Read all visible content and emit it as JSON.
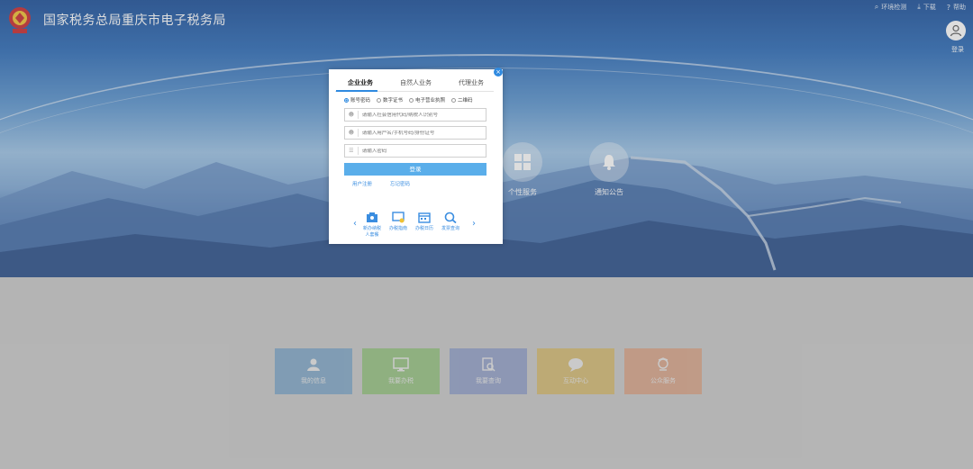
{
  "header": {
    "site_title": "国家税务总局重庆市电子税务局",
    "links": [
      {
        "label": "环境检测",
        "icon": "magnifier-icon"
      },
      {
        "label": "下载",
        "icon": "download-icon"
      },
      {
        "label": "帮助",
        "icon": "help-icon"
      }
    ],
    "user_login_label": "登录"
  },
  "hero_features": [
    {
      "label": "个性服务",
      "icon": "grid-icon"
    },
    {
      "label": "通知公告",
      "icon": "bell-icon"
    }
  ],
  "login_modal": {
    "tabs": [
      {
        "label": "企业业务",
        "active": true
      },
      {
        "label": "自然人业务",
        "active": false
      },
      {
        "label": "代理业务",
        "active": false
      }
    ],
    "login_methods": [
      {
        "label": "账号密码",
        "checked": true
      },
      {
        "label": "数字证书",
        "checked": false
      },
      {
        "label": "电子营业执照",
        "checked": false
      },
      {
        "label": "二维码",
        "checked": false
      }
    ],
    "fields": {
      "credit_code_placeholder": "请输入社会信用代码/纳税人识别号",
      "username_placeholder": "请输入用户名/手机号码/身份证号",
      "password_placeholder": "请输入密码"
    },
    "login_button": "登录",
    "links": {
      "register": "用户注册",
      "forgot_password": "忘记密码"
    },
    "quick_items": [
      {
        "label": "新办纳税人套餐",
        "icon": "new-taxpayer-icon"
      },
      {
        "label": "办税指南",
        "icon": "guide-icon"
      },
      {
        "label": "办税日历",
        "icon": "calendar-icon"
      },
      {
        "label": "发票查询",
        "icon": "invoice-search-icon"
      }
    ],
    "nav_prev": "‹",
    "nav_next": "›",
    "close": "×"
  },
  "bottom_tiles": [
    {
      "label": "我的信息",
      "icon": "user-icon",
      "color": "#4a90c8"
    },
    {
      "label": "我要办税",
      "icon": "monitor-icon",
      "color": "#6fbf4a"
    },
    {
      "label": "我要查询",
      "icon": "document-search-icon",
      "color": "#6a84c8"
    },
    {
      "label": "互动中心",
      "icon": "chat-icon",
      "color": "#e0b030"
    },
    {
      "label": "公众服务",
      "icon": "public-service-icon",
      "color": "#e58a5a"
    }
  ],
  "colors": {
    "accent": "#2f8ae0",
    "button": "#5aaeea"
  }
}
